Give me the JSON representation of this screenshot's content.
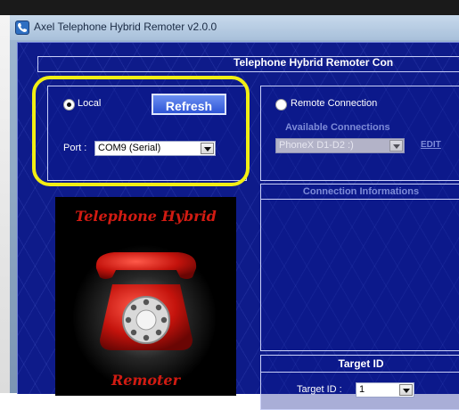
{
  "window": {
    "title": "Axel Telephone Hybrid Remoter v2.0.0",
    "header_title": "Telephone Hybrid Remoter Con"
  },
  "local": {
    "radio_label": "Local",
    "selected": true,
    "refresh_label": "Refresh",
    "port_label": "Port :",
    "port_value": "COM9 (Serial)"
  },
  "remote": {
    "radio_label": "Remote Connection",
    "selected": false,
    "available_label": "Available Connections",
    "connection_value": "PhoneX D1-D2 :)",
    "edit_label": "EDIT"
  },
  "connection_info": {
    "header": "Connection Informations"
  },
  "target": {
    "header": "Target ID",
    "label": "Target ID :",
    "value": "1"
  },
  "logo": {
    "top_text": "Telephone Hybrid",
    "bottom_text": "Remoter"
  },
  "colors": {
    "background_blue": "#0e1b8a",
    "highlight_yellow": "#f2ee13",
    "button_blue": "#2e55d6",
    "logo_red": "#d11b12"
  }
}
